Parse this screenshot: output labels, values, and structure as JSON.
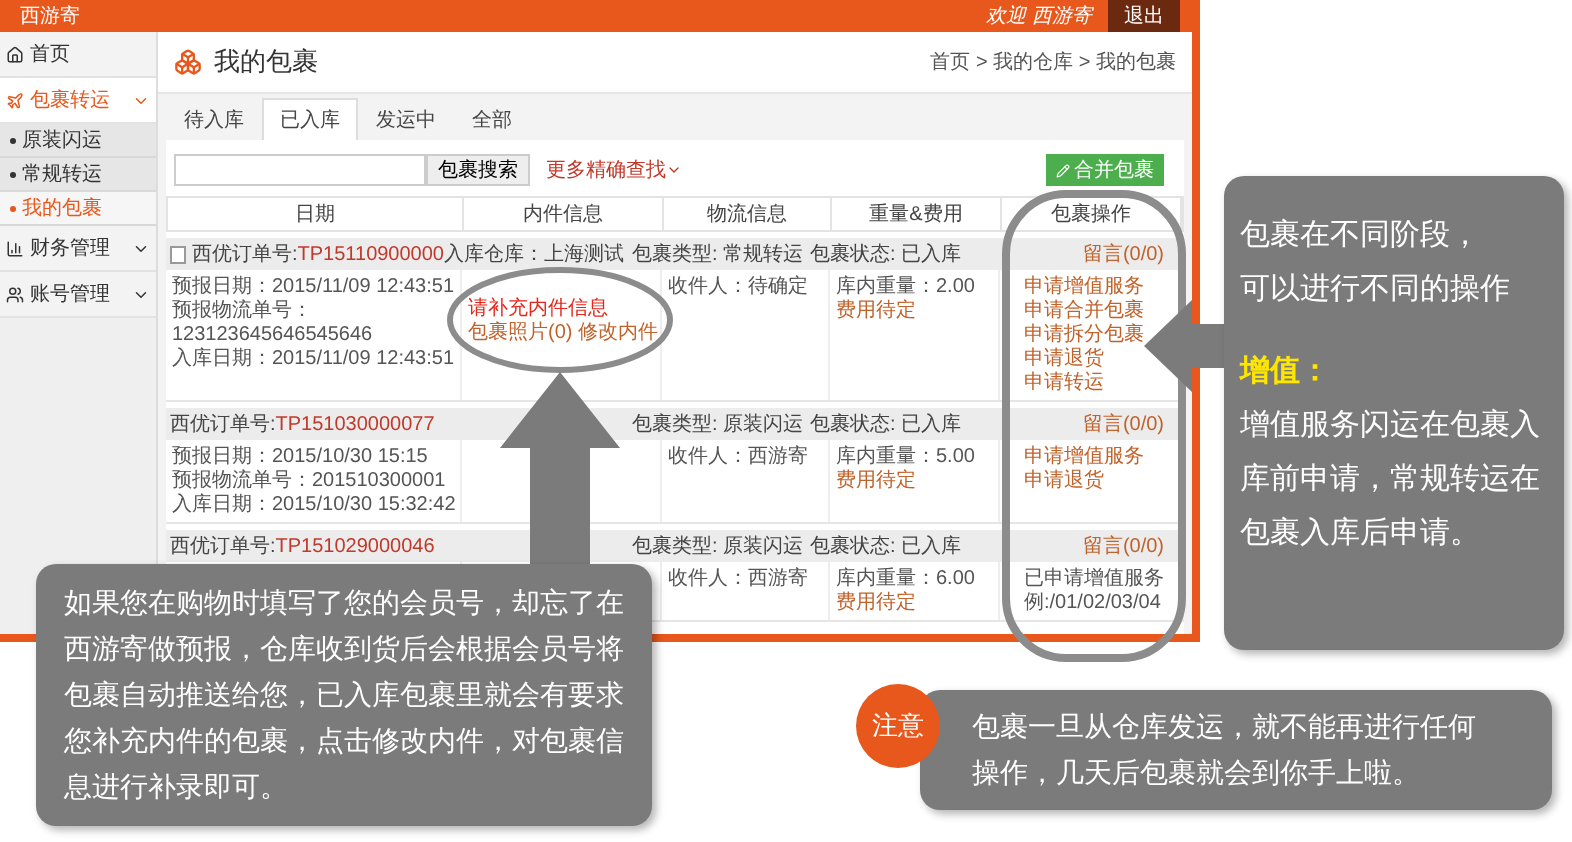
{
  "header": {
    "brand": "西游寄",
    "welcome": "欢迎 西游寄",
    "logout": "退出"
  },
  "sidebar": {
    "items": [
      {
        "label": "首页",
        "kind": "link",
        "selected": false
      },
      {
        "label": "包裹转运",
        "kind": "menu",
        "selected": true,
        "children": [
          {
            "label": "原装闪运",
            "selected": false
          },
          {
            "label": "常规转运",
            "selected": false
          },
          {
            "label": "我的包裹",
            "selected": true
          }
        ]
      },
      {
        "label": "财务管理",
        "kind": "menu",
        "selected": false
      },
      {
        "label": "账号管理",
        "kind": "menu",
        "selected": false
      }
    ]
  },
  "page": {
    "title": "我的包裹",
    "breadcrumb": "首页 > 我的仓库 > 我的包裹"
  },
  "tabs": [
    {
      "label": "待入库",
      "selected": false
    },
    {
      "label": "已入库",
      "selected": true
    },
    {
      "label": "发运中",
      "selected": false
    },
    {
      "label": "全部",
      "selected": false
    }
  ],
  "search": {
    "button": "包裹搜索",
    "more": "更多精确查找"
  },
  "merge_button": "合并包裹",
  "columns": [
    "日期",
    "内件信息",
    "物流信息",
    "重量&费用",
    "包裹操作"
  ],
  "packages": [
    {
      "checked": false,
      "order_label": "西优订单号:",
      "order_no": "TP15110900000",
      "warehouse": "入库仓库：上海测试",
      "type": "包裹类型: 常规转运",
      "status": "包裹状态: 已入库",
      "message": "留言(0/0)",
      "dates": [
        "预报日期：2015/11/09 12:43:51",
        "预报物流单号：",
        "123123645646545646",
        "入库日期：2015/11/09 12:43:51"
      ],
      "contents": [
        {
          "text": "请补充内件信息",
          "kind": "alert"
        },
        {
          "text": "包裹照片(0) 修改内件",
          "kind": "link"
        }
      ],
      "recipient": "收件人：待确定",
      "weight": "库内重量：2.00",
      "fee": "费用待定",
      "actions": [
        {
          "text": "申请增值服务",
          "kind": "link"
        },
        {
          "text": "申请合并包裹",
          "kind": "link"
        },
        {
          "text": "申请拆分包裹",
          "kind": "link"
        },
        {
          "text": "申请退货",
          "kind": "link"
        },
        {
          "text": "申请转运",
          "kind": "link"
        }
      ]
    },
    {
      "order_label": "西优订单号:",
      "order_no": "TP151030000077",
      "type": "包裹类型: 原装闪运",
      "status": "包裹状态: 已入库",
      "message": "留言(0/0)",
      "dates": [
        "预报日期：2015/10/30 15:15",
        "预报物流单号：201510300001",
        "入库日期：2015/10/30 15:32:42"
      ],
      "recipient": "收件人：西游寄",
      "weight": "库内重量：5.00",
      "fee": "费用待定",
      "actions": [
        {
          "text": "申请增值服务",
          "kind": "link"
        },
        {
          "text": "申请退货",
          "kind": "link"
        }
      ]
    },
    {
      "order_label": "西优订单号:",
      "order_no": "TP151029000046",
      "type": "包裹类型: 原装闪运",
      "status": "包裹状态: 已入库",
      "message": "留言(0/0)",
      "recipient": "收件人：西游寄",
      "weight": "库内重量：6.00",
      "fee": "费用待定",
      "actions": [
        {
          "text": "已申请增值服务",
          "kind": "note"
        },
        {
          "text": "例:/01/02/03/04",
          "kind": "note"
        }
      ]
    }
  ],
  "callouts": {
    "tip": "如果您在购物时填写了您的会员号，却忘了在西游寄做预报，仓库收到货后会根据会员号将包裹自动推送给您，已入库包裹里就会有要求您补充内件的包裹，点击修改内件，对包裹信息进行补录即可。",
    "stages": {
      "lines": [
        "包裹在不同阶段，",
        "可以进行不同的操作"
      ],
      "highlight": "增值：",
      "body": "增值服务闪运在包裹入库前申请，常规转运在包裹入库后申请。"
    },
    "note": {
      "badge": "注意",
      "text": "包裹一旦从仓库发运，就不能再进行任何操作，几天后包裹就会到你手上啦。"
    }
  }
}
